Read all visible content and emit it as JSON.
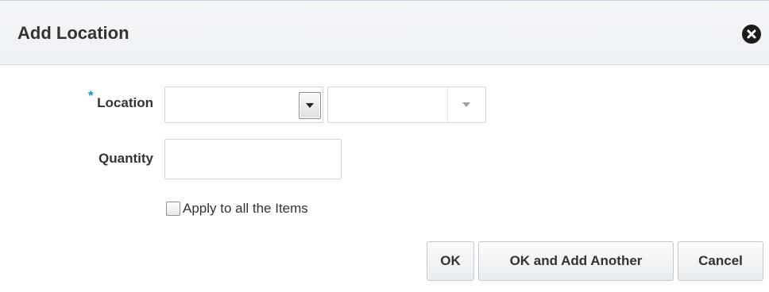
{
  "dialog": {
    "title": "Add Location",
    "close_icon": "close-circle-icon"
  },
  "form": {
    "location": {
      "required_marker": "*",
      "label": "Location",
      "type_value": "",
      "value": "",
      "dropdown_icon": "chevron-down-icon"
    },
    "quantity": {
      "label": "Quantity",
      "value": ""
    },
    "apply_all": {
      "label": "Apply to all the Items",
      "checked": false
    }
  },
  "buttons": {
    "ok": "OK",
    "ok_add_another": "OK and Add Another",
    "cancel": "Cancel"
  },
  "colors": {
    "required": "#1a8ad2",
    "text": "#333333",
    "header_bg": "#f4f6f8"
  }
}
